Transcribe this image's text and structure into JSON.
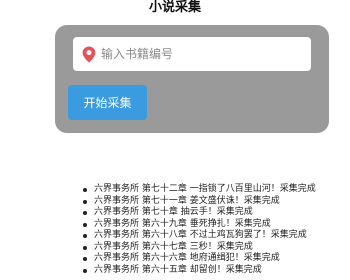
{
  "page": {
    "title": "小说采集"
  },
  "search": {
    "placeholder": "输入书籍编号",
    "value": ""
  },
  "actions": {
    "start_label": "开始采集"
  },
  "log": {
    "items": [
      "六界事务所 第七十二章 一指锁了八百里山河！采集完成",
      "六界事务所 第七十一章 姜文盛伏诛！采集完成",
      "六界事务所 第七十章 抽云手！采集完成",
      "六界事务所 第六十九章 垂死挣扎！采集完成",
      "六界事务所 第六十八章 不过土鸡瓦狗罢了！采集完成",
      "六界事务所 第六十七章 三秒！采集完成",
      "六界事务所 第六十六章 地府通缉犯！采集完成",
      "六界事务所 第六十五章 却留创！采集完成"
    ]
  },
  "colors": {
    "panel": "#9a9a9a",
    "button": "#3a9be0",
    "pin": "#e2545b"
  },
  "icons": {
    "search_field": "map-pin-icon"
  }
}
